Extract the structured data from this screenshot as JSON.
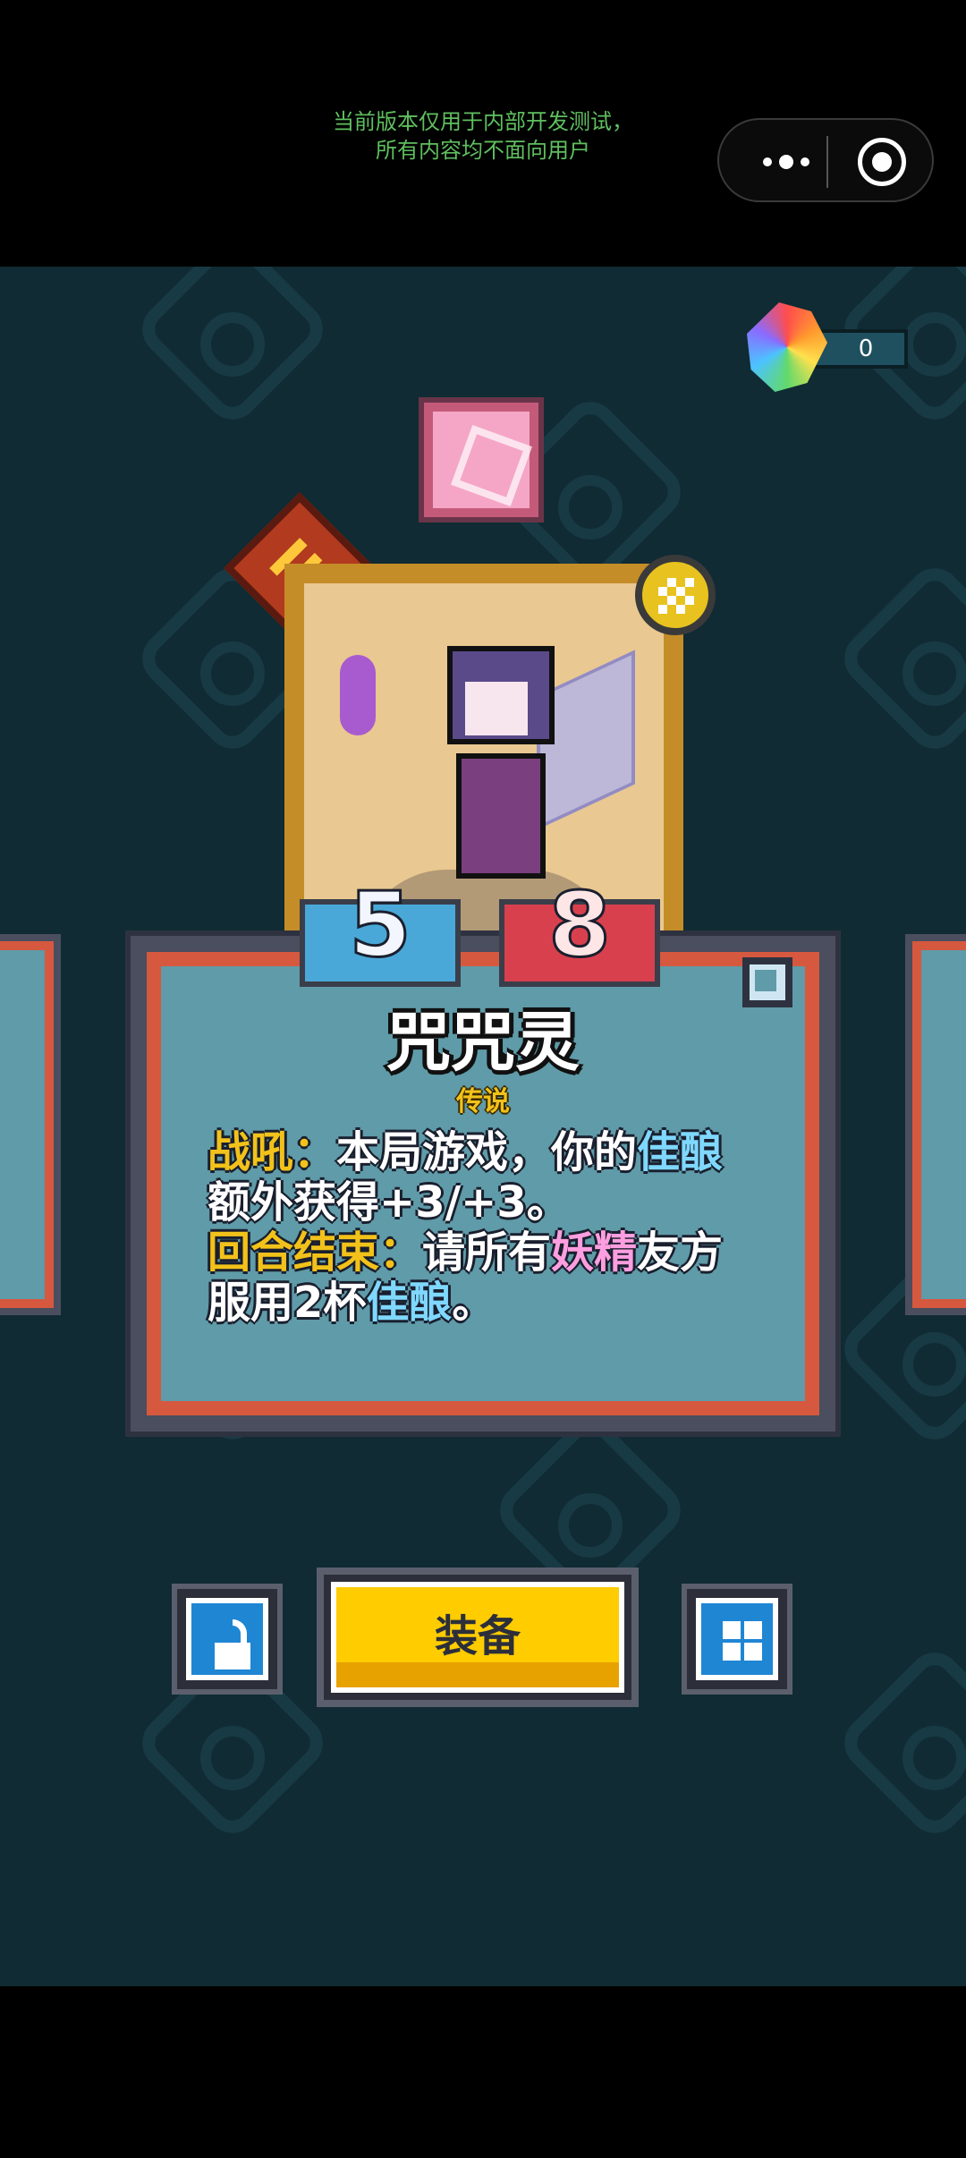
{
  "system": {
    "notice_line1": "当前版本仅用于内部开发测试，",
    "notice_line2": "所有内容均不面向用户",
    "capsule_more_icon": "more-dots-icon",
    "capsule_close_icon": "target-icon"
  },
  "currency": {
    "icon": "rainbow-gem-icon",
    "value": "0"
  },
  "card": {
    "attack": "5",
    "health": "8",
    "name": "咒咒灵",
    "rarity": "传说",
    "text": {
      "line1_kw": "战吼：",
      "line1_text": "本局游戏，你的",
      "line1_kw2": "佳酿",
      "line2_text": "额外获得+3/+3。",
      "line3_kw": "回合结束：",
      "line3_text": "请所有",
      "line3_kw2": "妖精",
      "line3_text2": "友方",
      "line4_text": "服用2杯",
      "line4_kw": "佳酿",
      "line4_end": "。"
    }
  },
  "buttons": {
    "lock_icon": "unlock-icon",
    "equip_label": "装备",
    "grid_icon": "grid-icon"
  },
  "colors": {
    "background": "#102b33",
    "card_border": "#d6583f",
    "card_fill": "#5f9ba8",
    "keyword_gold": "#f2c21a",
    "keyword_blue": "#7fd8ff",
    "keyword_pink": "#ff9ee0",
    "equip_button": "#ffcc00"
  }
}
